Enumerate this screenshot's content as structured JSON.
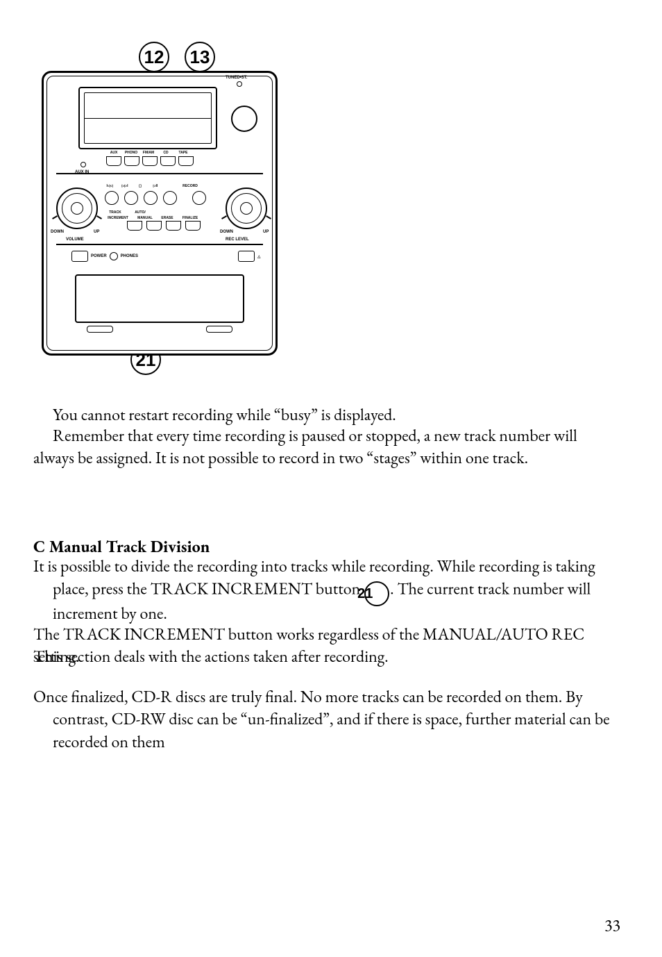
{
  "callouts": {
    "c12": "12",
    "c13": "13",
    "c21": "21"
  },
  "diagram": {
    "tuned": "TUNED•ST.",
    "sources": [
      "AUX",
      "PHONO",
      "FM/AM",
      "CD",
      "TAPE"
    ],
    "aux_in": "AUX IN",
    "transport": [
      "⏮",
      "⏭",
      "⏹",
      "⏯",
      "RECORD"
    ],
    "vol": "VOLUME",
    "rec_level": "REC LEVEL",
    "down": "DOWN",
    "up": "UP",
    "rec_opts_top": [
      "TRACK",
      "AUTO/"
    ],
    "rec_opts_bot": [
      "INCREMENT",
      "MANUAL",
      "ERASE",
      "FINALIZE"
    ],
    "power": "POWER",
    "phones": "PHONES"
  },
  "text": {
    "line1": "You cannot restart recording while “busy” is displayed.",
    "line2": "Remember that every time recording is paused or stopped, a new track number will always be assigned. It is not possible to record in two “stages” within one track.",
    "heading": "C Manual Track Division",
    "p3a": "It is possible to divide the recording into tracks while recording. While recording is taking place, press the TRACK INCREMENT button ",
    "p3b": ". The current track number will increment by one.",
    "p4": "The TRACK INCREMENT button works regardless of the MANUAL/AUTO REC setting.",
    "p5": "This section deals with the actions taken after recording.",
    "p6": "Once finalized, CD-R discs are truly final. No more tracks can be recorded on them. By contrast, CD-RW disc can be “un-finalized”, and if there is space, further material can be recorded on them",
    "inline21": "21"
  },
  "page_number": "33"
}
